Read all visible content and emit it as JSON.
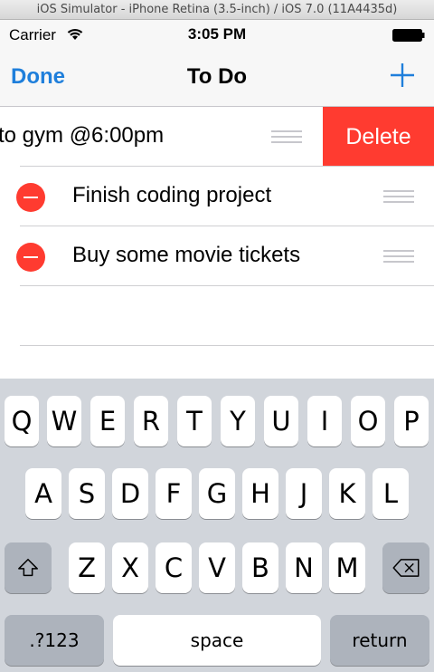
{
  "simulator_title": "iOS Simulator - iPhone Retina (3.5-inch) / iOS 7.0 (11A4435d)",
  "status_bar": {
    "carrier": "Carrier",
    "time": "3:05 PM"
  },
  "nav": {
    "left_button": "Done",
    "title": "To Do",
    "right_icon": "plus-icon"
  },
  "list": {
    "swiped_row_text": "to gym @6:00pm",
    "delete_action_label": "Delete",
    "items": [
      {
        "text": "Finish coding project"
      },
      {
        "text": "Buy some movie tickets"
      }
    ]
  },
  "keyboard": {
    "row1": [
      "Q",
      "W",
      "E",
      "R",
      "T",
      "Y",
      "U",
      "I",
      "O",
      "P"
    ],
    "row2": [
      "A",
      "S",
      "D",
      "F",
      "G",
      "H",
      "J",
      "K",
      "L"
    ],
    "row3": [
      "Z",
      "X",
      "C",
      "V",
      "B",
      "N",
      "M"
    ],
    "numbers_label": ".?123",
    "space_label": "space",
    "return_label": "return",
    "shift_icon": "shift-icon",
    "backspace_icon": "backspace-icon"
  },
  "colors": {
    "accent": "#1f7fdb",
    "delete": "#ff3b30",
    "keyboard_bg": "#d1d5db"
  }
}
